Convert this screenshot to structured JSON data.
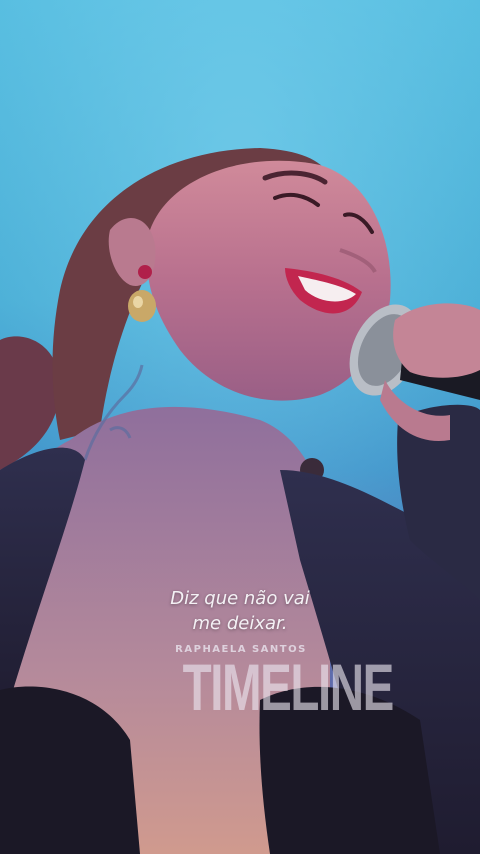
{
  "subtitle": {
    "line1": "Diz que não vai",
    "line2": "me deixar."
  },
  "brand": {
    "artist": "RAPHAELA SANTOS",
    "title": "TIMELINE"
  }
}
